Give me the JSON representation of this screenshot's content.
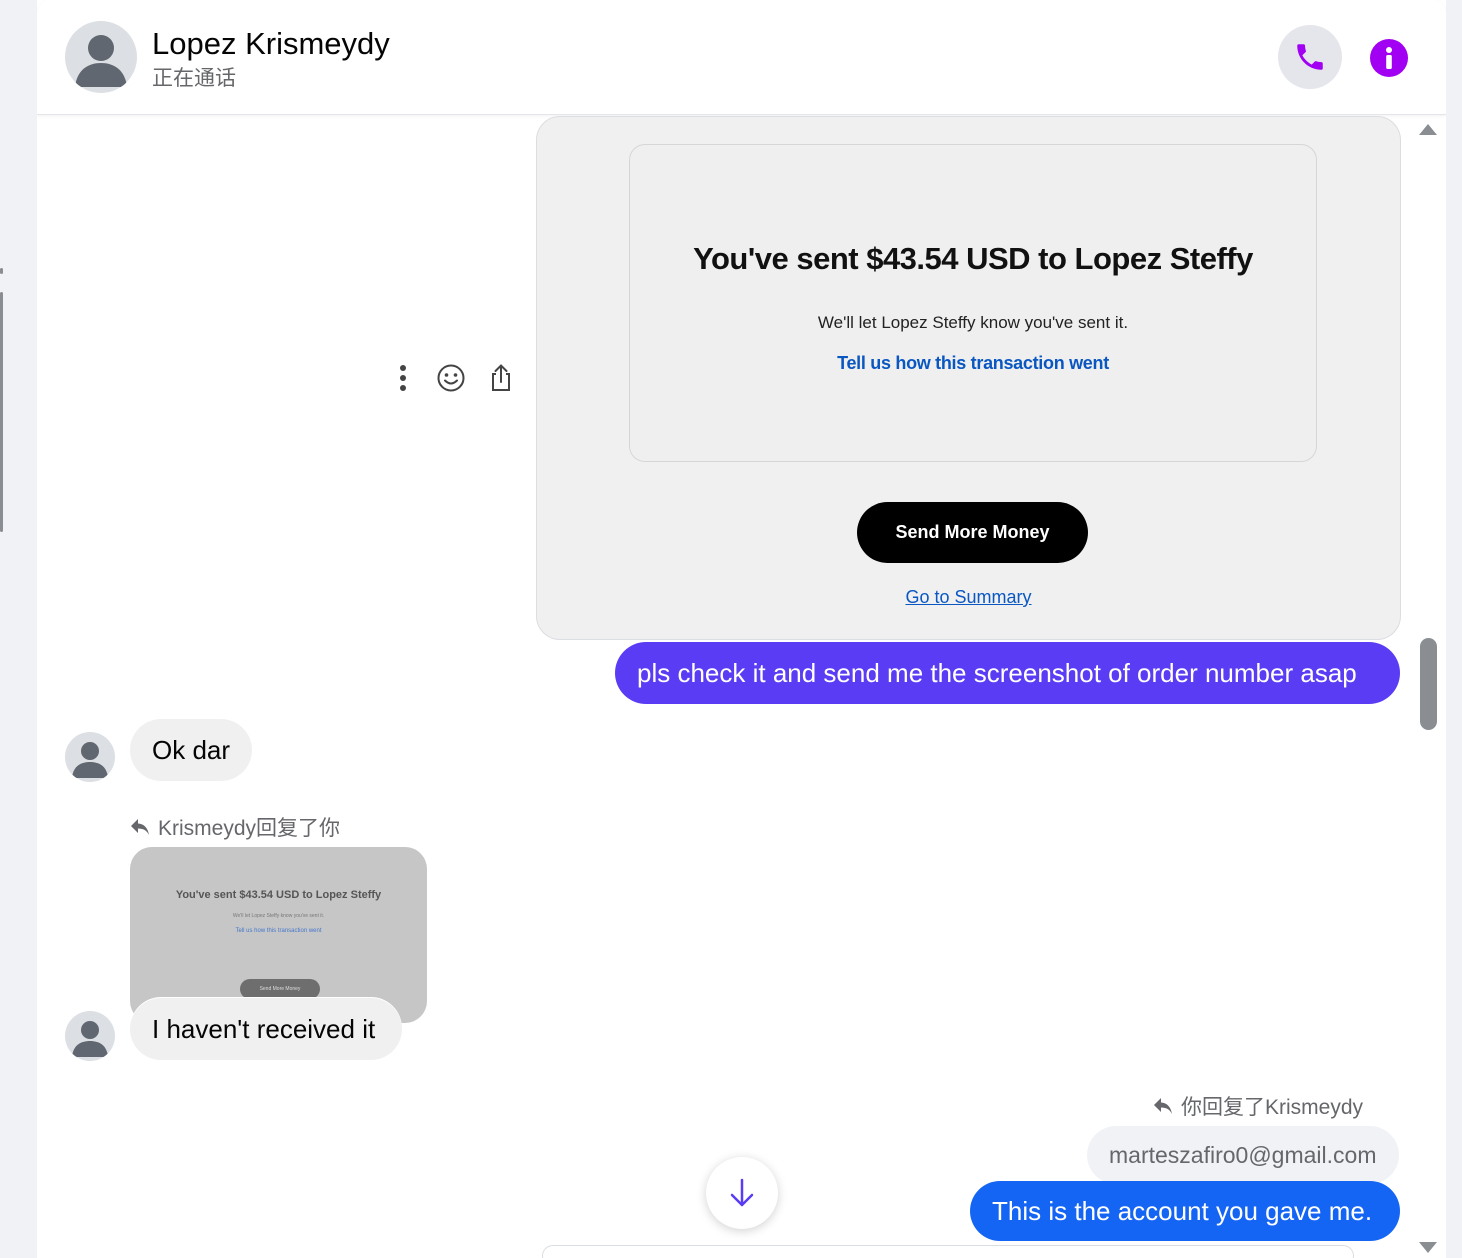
{
  "header": {
    "contact_name": "Lopez Krismeydy",
    "status": "正在通话"
  },
  "card": {
    "title": "You've sent $43.54 USD to Lopez Steffy",
    "subtitle": "We'll let Lopez Steffy know you've sent it.",
    "feedback_link": "Tell us how this transaction went",
    "send_more_label": "Send More Money",
    "summary_link": "Go to Summary"
  },
  "messages": [
    {
      "direction": "outgoing",
      "text": "pls check it and send me the screenshot of order number asap"
    },
    {
      "direction": "incoming",
      "text": "Ok dar"
    },
    {
      "direction": "incoming",
      "reply_label": "Krismeydy回复了你",
      "text": "I haven't received it"
    },
    {
      "direction": "outgoing",
      "reply_label": "你回复了Krismeydy",
      "quoted_text": "marteszafiro0@gmail.com",
      "text": "This is the account you gave me."
    }
  ],
  "thumbnail": {
    "title": "You've sent $43.54 USD to Lopez Steffy",
    "subtitle": "We'll let Lopez Steffy know you've sent it.",
    "link": "Tell us how this transaction went",
    "button": "Send More Money"
  },
  "colors": {
    "accent_purple": "#a100f2",
    "outgoing_purple": "#5b3cf5",
    "outgoing_blue": "#1565f5",
    "incoming_grey": "#f0f0f0",
    "link_blue": "#0a57c2"
  },
  "icons": {
    "call": "phone-icon",
    "info": "info-icon",
    "more": "more-vertical-icon",
    "react": "emoji-icon",
    "share": "share-icon",
    "reply": "reply-icon",
    "scroll_down": "arrow-down-icon"
  }
}
